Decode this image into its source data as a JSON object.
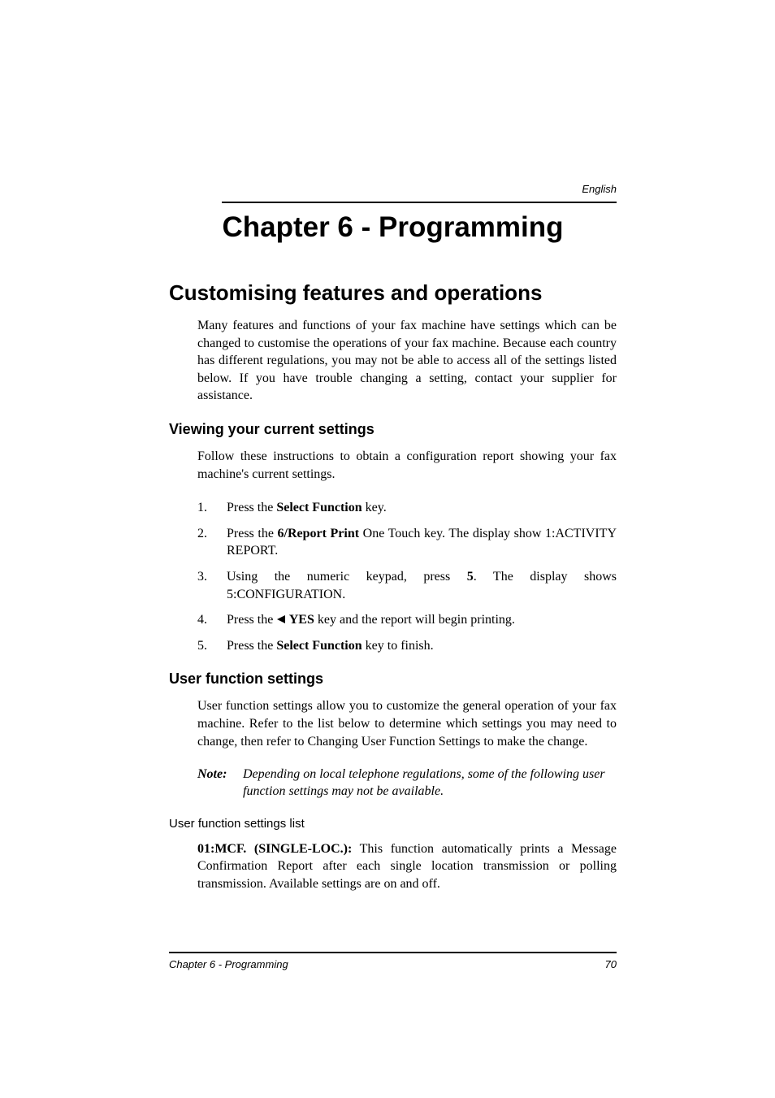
{
  "header": {
    "language": "English"
  },
  "chapter": {
    "title": "Chapter 6 - Programming"
  },
  "section": {
    "title": "Customising features and operations",
    "intro": "Many features and functions of your fax machine have settings which can be changed to customise the operations of your fax machine. Because each country has different regulations, you may not be able to access all of the settings listed below. If you have trouble changing a setting, contact your supplier for assistance."
  },
  "viewing": {
    "title": "Viewing your current settings",
    "intro": "Follow these instructions to obtain a configuration report showing your fax machine's current settings.",
    "steps": {
      "s1_pre": "Press the ",
      "s1_bold": "Select Function",
      "s1_post": " key.",
      "s2_pre": "Press the ",
      "s2_bold": "6/Report Print",
      "s2_post": " One Touch key. The display show 1:ACTIVITY REPORT.",
      "s3_pre": "Using the numeric keypad, press ",
      "s3_bold": "5",
      "s3_post": ". The display shows 5:CONFIGURATION.",
      "s4_pre": "Press the ",
      "s4_bold": " YES",
      "s4_post": " key and the report will begin printing.",
      "s5_pre": "Press the ",
      "s5_bold": "Select Function",
      "s5_post": " key to finish."
    }
  },
  "userfunc": {
    "title": "User function settings",
    "intro": "User function settings allow you to customize the general operation of your fax machine. Refer to the list below to determine which settings you may need to change, then refer to Changing User Function Settings to make the change.",
    "note_label": "Note:",
    "note_text": "Depending on local telephone regulations, some of the following user function settings may not be available.",
    "list_title": "User function settings list",
    "item1_bold": "01:MCF. (SINGLE-LOC.):",
    "item1_text": " This function automatically prints a Message Confirmation Report after each single location transmission or polling transmission. Available settings are on and off."
  },
  "footer": {
    "left": "Chapter 6 - Programming",
    "right": "70"
  },
  "nums": {
    "n1": "1.",
    "n2": "2.",
    "n3": "3.",
    "n4": "4.",
    "n5": "5."
  }
}
